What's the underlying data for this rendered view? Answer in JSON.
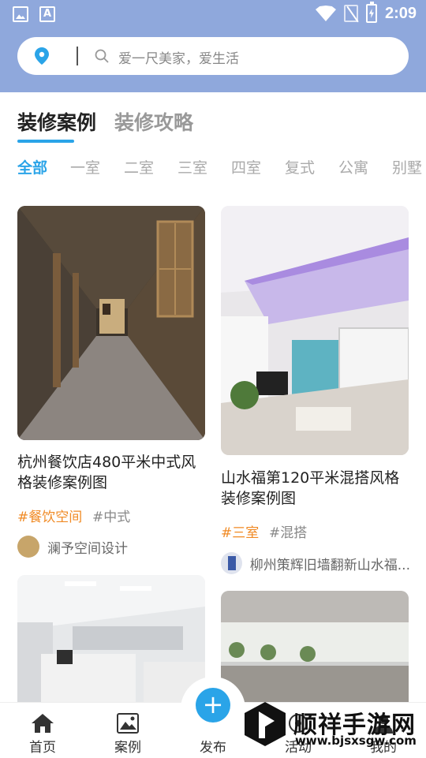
{
  "status_bar": {
    "time": "2:09",
    "icons": [
      "image-icon",
      "font-a-icon",
      "wifi-icon",
      "no-sim-icon",
      "battery-charging-icon"
    ]
  },
  "search": {
    "placeholder": "爱一尺美家，爱生活",
    "location_icon": "location-pin-icon",
    "search_icon": "search-icon"
  },
  "tabs": [
    {
      "label": "装修案例",
      "active": true
    },
    {
      "label": "装修攻略",
      "active": false
    }
  ],
  "categories": [
    {
      "label": "全部",
      "active": true
    },
    {
      "label": "一室"
    },
    {
      "label": "二室"
    },
    {
      "label": "三室"
    },
    {
      "label": "四室"
    },
    {
      "label": "复式"
    },
    {
      "label": "公寓"
    },
    {
      "label": "别墅"
    }
  ],
  "cards": [
    {
      "title": "杭州餐饮店480平米中式风格装修案例图",
      "tags": [
        "#餐饮空间",
        "#中式"
      ],
      "author": "澜予空间设计"
    },
    {
      "title": "山水福第120平米混搭风格装修案例图",
      "tags": [
        "#三室",
        "#混搭"
      ],
      "author": "柳州策辉旧墙翻新山水福..."
    }
  ],
  "colors": {
    "accent": "#2aa4e8",
    "header": "#8fa8dc",
    "tag_orange": "#f08a24"
  },
  "bottom_nav": [
    {
      "label": "首页",
      "icon": "home-icon"
    },
    {
      "label": "案例",
      "icon": "image-icon"
    },
    {
      "label": "发布",
      "icon": "plus-icon"
    },
    {
      "label": "活动",
      "icon": "activity-icon"
    },
    {
      "label": "我的",
      "icon": "user-icon"
    }
  ],
  "fab": {
    "symbol": "+"
  },
  "watermark": {
    "name": "顺祥手游网",
    "url": "www.bjsxsgw.com"
  }
}
